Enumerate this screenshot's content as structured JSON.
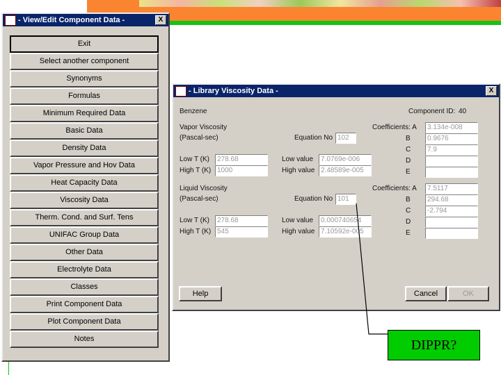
{
  "main_window": {
    "title": "- View/Edit Component Data -",
    "close_label": "X",
    "buttons": [
      "Exit",
      "Select another component",
      "Synonyms",
      "Formulas",
      "Minimum Required Data",
      "Basic Data",
      "Density Data",
      "Vapor Pressure and Hov Data",
      "Heat Capacity Data",
      "Viscosity Data",
      "Therm. Cond. and Surf. Tens",
      "UNIFAC Group Data",
      "Other Data",
      "Electrolyte Data",
      "Classes",
      "Print Component Data",
      "Plot Component Data",
      "Notes"
    ]
  },
  "viscosity_window": {
    "title": "- Library Viscosity Data -",
    "close_label": "X",
    "component": "Benzene",
    "component_id_label": "Component ID:",
    "component_id": "40",
    "vapor": {
      "heading": "Vapor Viscosity",
      "units": "(Pascal-sec)",
      "equation_label": "Equation No",
      "equation": "102",
      "coeff_label": "Coefficients: A",
      "coeffs": [
        "3.134e-008",
        "0.9676",
        "7.9",
        "",
        ""
      ],
      "low_t_label": "Low T (K)",
      "low_t": "278.68",
      "high_t_label": "High T (K)",
      "high_t": "1000",
      "low_value_label": "Low value",
      "low_value": "7.0769e-006",
      "high_value_label": "High value",
      "high_value": "2.48589e-005"
    },
    "liquid": {
      "heading": "Liquid Viscosity",
      "units": "(Pascal-sec)",
      "equation_label": "Equation No",
      "equation": "101",
      "coeff_label": "Coefficients: A",
      "coeffs": [
        "7.5117",
        "294.68",
        "-2.794",
        "",
        ""
      ],
      "low_t_label": "Low T (K)",
      "low_t": "278.68",
      "high_t_label": "High T (K)",
      "high_t": "545",
      "low_value_label": "Low value",
      "low_value": "0.000740654",
      "high_value_label": "High value",
      "high_value": "7.10592e-005"
    },
    "coeff_letters": [
      "B",
      "C",
      "D",
      "E"
    ],
    "help": "Help",
    "cancel": "Cancel",
    "ok": "OK"
  },
  "annotation": "DIPPR?"
}
